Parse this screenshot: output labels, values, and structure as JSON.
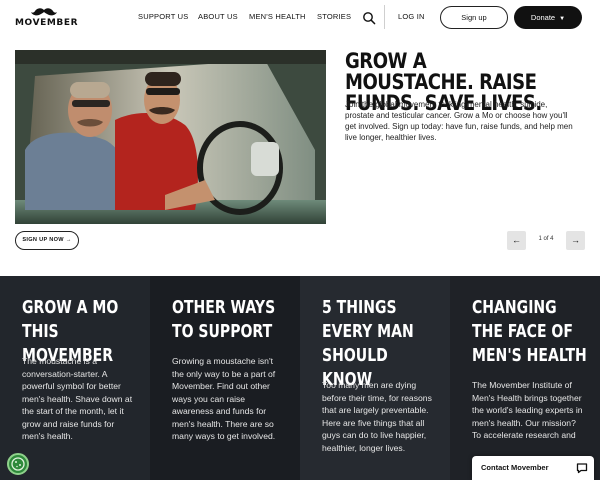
{
  "header": {
    "logo_text": "MOVEMBER",
    "nav": [
      "SUPPORT US",
      "ABOUT US",
      "MEN'S HEALTH",
      "STORIES"
    ],
    "login": "LOG IN",
    "signup": "Sign up",
    "donate": "Donate"
  },
  "hero": {
    "title": "GROW A MOUSTACHE. RAISE FUNDS. SAVE LIVES.",
    "description": "Join the global movement tackling mental health, suicide, prostate and testicular cancer. Grow a Mo or choose how you'll get involved. Sign up today: have fun, raise funds, and help men live longer, healthier lives.",
    "cta": "SIGN UP NOW",
    "pager": "1 of 4"
  },
  "cards": [
    {
      "title": "GROW A MO THIS MOVEMBER",
      "body": "The moustache is a conversation-starter. A powerful symbol for better men's health. Shave down at the start of the month, let it grow and raise funds for men's health."
    },
    {
      "title": "OTHER WAYS TO SUPPORT",
      "body": "Growing a moustache isn't the only way to be a part of Movember. Find out other ways you can raise awareness and funds for men's health. There are so many ways to get involved."
    },
    {
      "title": "5 THINGS EVERY MAN SHOULD KNOW",
      "body": "Too many men are dying before their time, for reasons that are largely preventable. Here are five things that all guys can do to live happier, healthier, longer lives."
    },
    {
      "title": "CHANGING THE FACE OF MEN'S HEALTH",
      "body": "The Movember Institute of Men's Health brings together the world's leading experts in men's health. Our mission? To accelerate research and"
    }
  ],
  "contact": {
    "label": "Contact Movember"
  },
  "icons": {
    "search": "search-icon",
    "donate_chevron": "chevron-down-icon",
    "prev": "arrow-left-icon",
    "next": "arrow-right-icon",
    "cookie": "cookie-icon",
    "chat": "chat-icon",
    "logo": "moustache-icon"
  },
  "colors": {
    "dark_section": "#1b1e23",
    "donate_bg": "#111111",
    "cookie": "#2f8a3b"
  }
}
